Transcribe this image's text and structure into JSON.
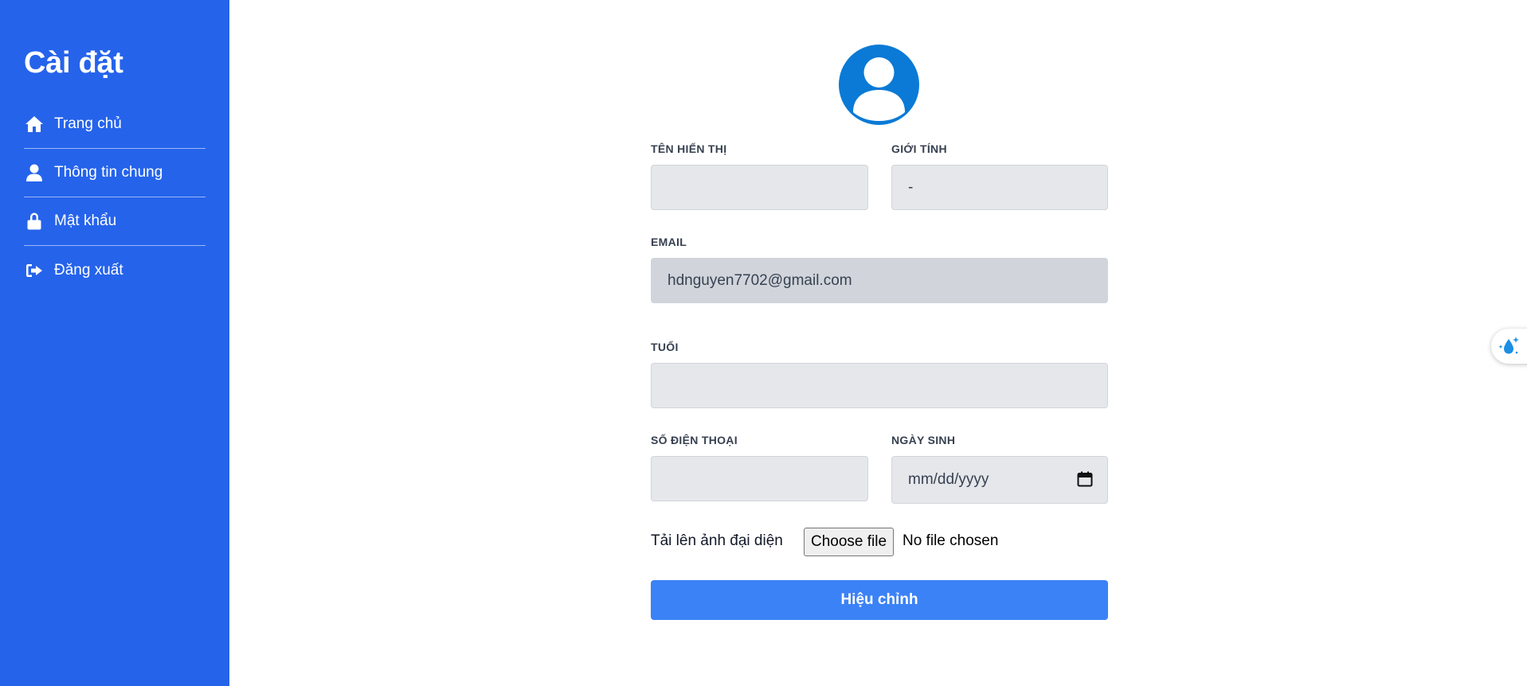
{
  "sidebar": {
    "title": "Cài đặt",
    "items": [
      {
        "label": "Trang chủ",
        "icon": "home-icon"
      },
      {
        "label": "Thông tin chung",
        "icon": "user-icon"
      },
      {
        "label": "Mật khẩu",
        "icon": "lock-icon"
      },
      {
        "label": "Đăng xuất",
        "icon": "logout-icon"
      }
    ]
  },
  "form": {
    "display_name": {
      "label": "TÊN HIỂN THỊ",
      "value": ""
    },
    "gender": {
      "label": "GIỚI TÍNH",
      "value": "-"
    },
    "email": {
      "label": "EMAIL",
      "value": "hdnguyen7702@gmail.com"
    },
    "age": {
      "label": "TUỔI",
      "value": ""
    },
    "phone": {
      "label": "SỐ ĐIỆN THOẠI",
      "value": ""
    },
    "birthday": {
      "label": "NGÀY SINH",
      "placeholder": "mm/dd/yyyy"
    },
    "upload": {
      "label": "Tải lên ảnh đại diện",
      "button": "Choose file",
      "status": "No file chosen"
    },
    "submit_label": "Hiệu chỉnh"
  },
  "colors": {
    "sidebar_bg": "#2563eb",
    "button_bg": "#3b82f6",
    "avatar_bg": "#0a7ad6"
  }
}
